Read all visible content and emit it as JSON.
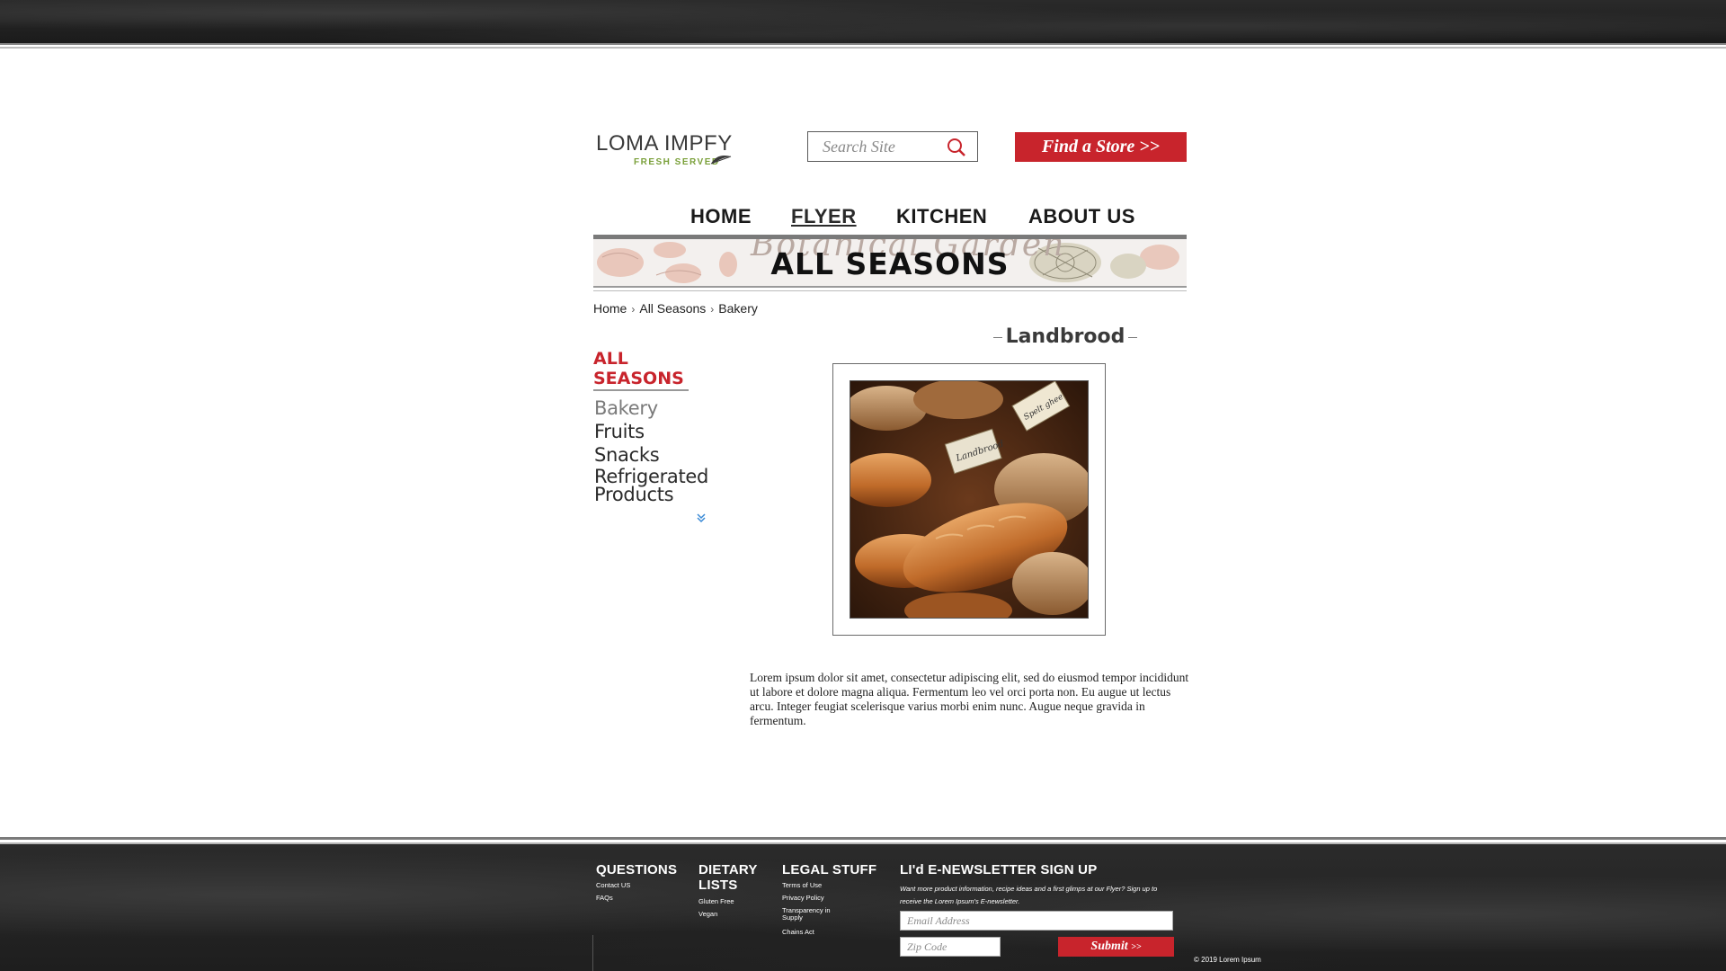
{
  "header": {
    "logo": {
      "name": "LOMA IMPFY",
      "tagline": "FRESH SERVED"
    },
    "search": {
      "placeholder": "Search Site"
    },
    "find_store_label": "Find a Store >>"
  },
  "nav": {
    "items": [
      {
        "label": "HOME",
        "active": false
      },
      {
        "label": "FLYER",
        "active": true
      },
      {
        "label": "KITCHEN",
        "active": false
      },
      {
        "label": "ABOUT US",
        "active": false
      }
    ]
  },
  "banner": {
    "script_text": "Botanical Garden",
    "title": "ALL SEASONS"
  },
  "breadcrumb": {
    "items": [
      "Home",
      "All Seasons",
      "Bakery"
    ],
    "separator": "›"
  },
  "sidebar": {
    "title": "ALL SEASONS",
    "items": [
      {
        "label": "Bakery",
        "active": true
      },
      {
        "label": "Fruits",
        "active": false
      },
      {
        "label": "Snacks",
        "active": false
      },
      {
        "label": "Refrigerated Products",
        "active": false
      }
    ],
    "more_icon": "double-chevron-down-icon"
  },
  "product": {
    "title": "Landbrood",
    "tag_labels": [
      "Landbrood",
      "Spelt ghee"
    ],
    "description": "Lorem ipsum dolor sit amet, consectetur adipiscing elit, sed do eiusmod tempor incididunt ut labore et dolore magna aliqua. Fermentum leo vel orci porta non. Eu augue ut lectus arcu. Integer feugiat scelerisque varius morbi enim nunc. Augue neque gravida in fermentum."
  },
  "footer": {
    "columns": [
      {
        "title": "QUESTIONS",
        "links": [
          "Contact US",
          "FAQs"
        ]
      },
      {
        "title": "DIETARY LISTS",
        "links": [
          "Gluten Free",
          "Vegan"
        ]
      },
      {
        "title": "LEGAL STUFF",
        "links": [
          "Terms of Use",
          "Privacy Policy",
          "Transparency in Supply",
          "Chains Act"
        ]
      }
    ],
    "newsletter": {
      "title": "LI'd E-NEWSLETTER SIGN UP",
      "note": "Want more product information, recipe ideas and a first glimps at our Flyer? Sign up to receive the Lorem Ipsum's E-newsletter.",
      "email_placeholder": "Email Address",
      "zip_placeholder": "Zip Code",
      "submit_label": "Submit"
    },
    "copyright": "© 2019 Lorem Ipsum"
  },
  "colors": {
    "accent": "#c8242c",
    "dark": "#1e1e1e",
    "logo_green": "#7aa03a"
  }
}
